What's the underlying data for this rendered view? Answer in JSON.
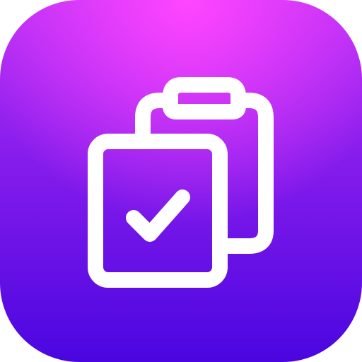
{
  "icon": {
    "name": "clipboard-check-icon",
    "colors": {
      "gradient_top": "#ff45ff",
      "gradient_mid": "#b52ef5",
      "gradient_bottom": "#4a06e0",
      "stroke": "#ffffff"
    }
  }
}
